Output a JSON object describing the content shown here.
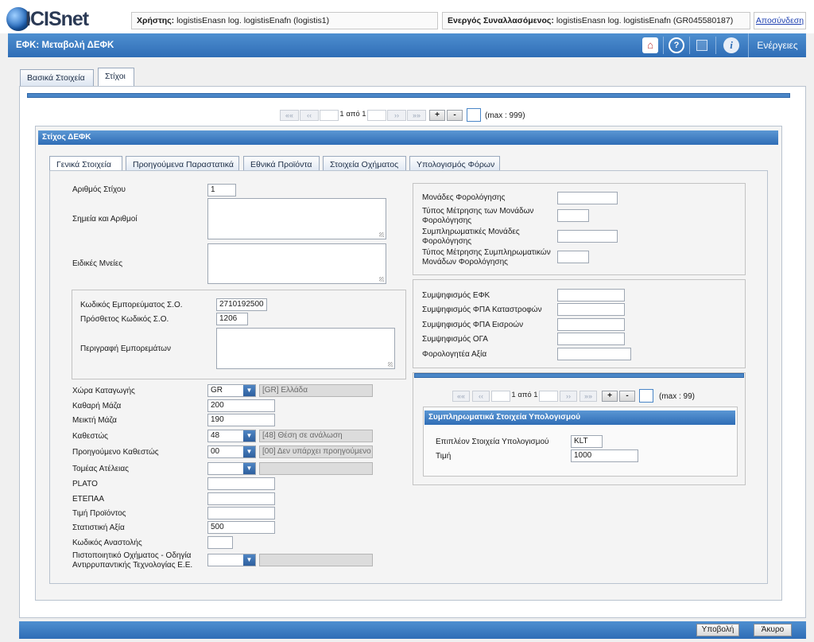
{
  "header": {
    "logo_text": "ICISnet",
    "user_label": "Χρήστης:",
    "user_value": "logistisEnasn log. logistisEnafn (logistis1)",
    "trader_label": "Ενεργός Συναλλασόμενος:",
    "trader_value": "logistisEnasn log. logistisEnafn (GR045580187)",
    "logout": "Αποσύνδεση"
  },
  "titlebar": {
    "title": "ΕΦΚ: Μεταβολή ΔΕΦΚ",
    "actions": "Ενέργειες",
    "icons": [
      "home-icon",
      "help-icon",
      "window-icon",
      "info-icon"
    ]
  },
  "main_tabs": [
    "Βασικά Στοιχεία",
    "Στίχοι"
  ],
  "pager_main": {
    "first": "««",
    "prev": "‹‹",
    "page": "1 από 1",
    "next": "››",
    "last": "»»",
    "plus": "+",
    "minus": "-",
    "max": "(max : 999)"
  },
  "section_title": "Στίχος ΔΕΦΚ",
  "sub_tabs": [
    "Γενικά Στοιχεία",
    "Προηγούμενα Παραστατικά",
    "Εθνικά Προϊόντα",
    "Στοιχεία Οχήματος",
    "Υπολογισμός Φόρων"
  ],
  "left": {
    "line_no_label": "Αριθμός Στίχου",
    "line_no": "1",
    "marks_label": "Σημεία και Αριθμοί",
    "special_label": "Ειδικές Μνείες",
    "cn_label": "Κωδικός Εμπορεύματος Σ.Ο.",
    "cn": "2710192500",
    "addcode_label": "Πρόσθετος Κωδικός Σ.Ο.",
    "addcode": "1206",
    "desc_label": "Περιγραφή Εμπορεμάτων",
    "origin_label": "Χώρα Καταγωγής",
    "origin": "GR",
    "origin_desc": "[GR] Ελλάδα",
    "net_label": "Καθαρή Μάζα",
    "net": "200",
    "gross_label": "Μεικτή Μάζα",
    "gross": "190",
    "status_label": "Καθεστώς",
    "status": "48",
    "status_desc": "[48] Θέση σε ανάλωση",
    "prev_status_label": "Προηγούμενο Καθεστώς",
    "prev_status": "00",
    "prev_status_desc": "[00] Δεν υπάρχει προηγούμενο Κ",
    "exempt_label": "Τομέας Ατέλειας",
    "plato_label": "PLATO",
    "etepaa_label": "ΕΤΕΠΑΑ",
    "price_label": "Τιμή Προϊόντος",
    "stat_label": "Στατιστική Αξία",
    "stat": "500",
    "suspend_label": "Κωδικός Αναστολής",
    "cert_label_1": "Πιστοποιητικό Οχήματος - Οδηγία",
    "cert_label_2": "Αντιρρυπαντικής Τεχνολογίας Ε.Ε."
  },
  "right": {
    "units_label": "Μονάδες Φορολόγησης",
    "units_type_label_1": "Τύπος Μέτρησης των Μονάδων",
    "units_type_label_2": "Φορολόγησης",
    "supp_units_label_1": "Συμπληρωματικές Μονάδες",
    "supp_units_label_2": "Φορολόγησης",
    "supp_type_label_1": "Τύπος Μέτρησης Συμπληρωματικών",
    "supp_type_label_2": "Μονάδων Φορολόγησης",
    "offset_efk_label": "Συμψηφισμός ΕΦΚ",
    "offset_vat_destr_label": "Συμψηφισμός ΦΠΑ Καταστροφών",
    "offset_vat_in_label": "Συμψηφισμός ΦΠΑ Εισροών",
    "offset_oga_label": "Συμψηφισμός ΟΓΑ",
    "taxable_label": "Φορολογητέα Αξία",
    "pager": {
      "first": "««",
      "prev": "‹‹",
      "page": "1 από 1",
      "next": "››",
      "last": "»»",
      "plus": "+",
      "minus": "-",
      "max": "(max : 99)"
    },
    "calc_title": "Συμπληρωματικά Στοιχεία Υπολογισμού",
    "extra_label": "Επιπλέον Στοιχεία Υπολογισμού",
    "extra": "KLT",
    "value_label": "Τιμή",
    "value": "1000"
  },
  "footer": {
    "submit": "Υποβολή",
    "cancel": "Άκυρο"
  }
}
